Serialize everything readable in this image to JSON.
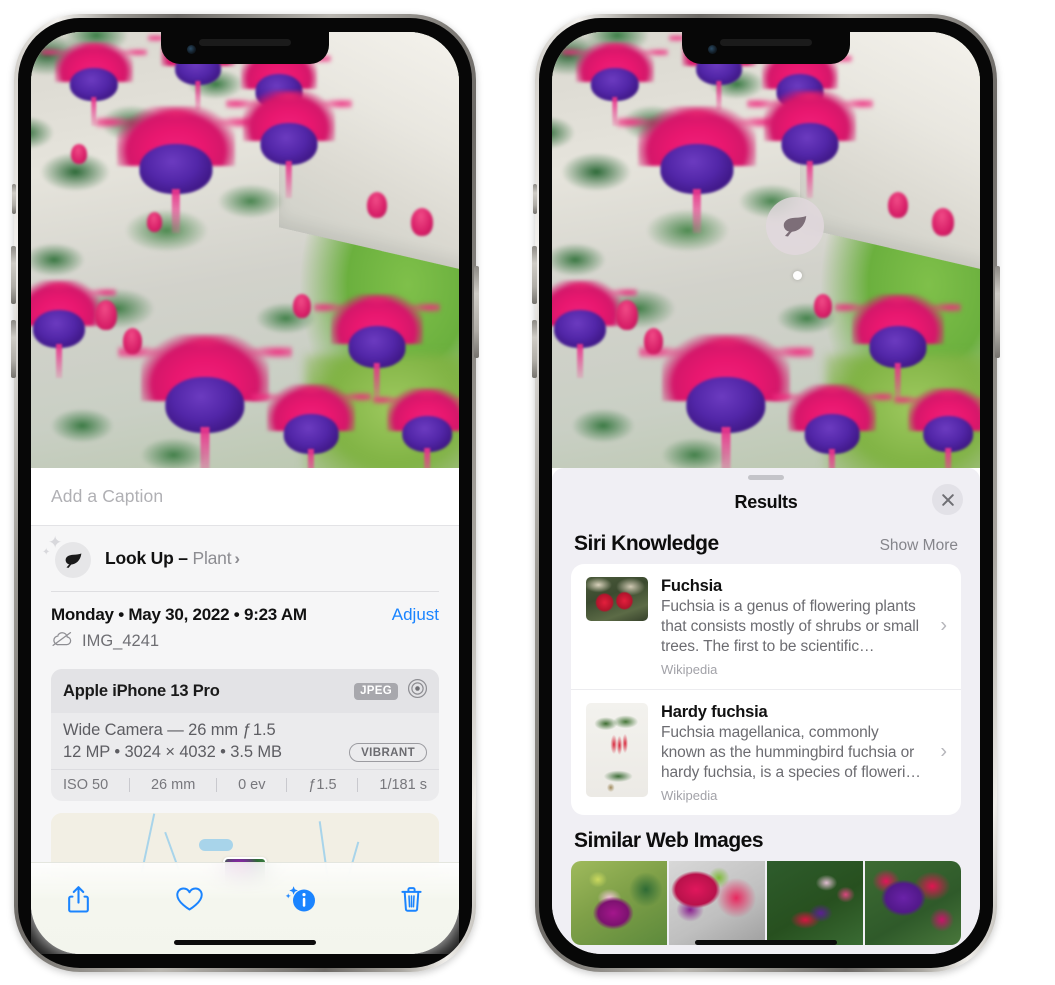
{
  "left_phone": {
    "name": "iphone-photos-info",
    "caption_field": {
      "placeholder": "Add a Caption",
      "value": ""
    },
    "look_up": {
      "icon": "leaf-icon",
      "label": "Look Up",
      "dash": "–",
      "subject": "Plant",
      "chevron": "›"
    },
    "date_row": {
      "date_text": "Monday • May 30, 2022 • 9:23 AM",
      "adjust_label": "Adjust"
    },
    "file_row": {
      "icon": "cloud-slash-icon",
      "filename": "IMG_4241"
    },
    "camera_card": {
      "model": "Apple iPhone 13 Pro",
      "format_badge": "JPEG",
      "aperture_icon": "camera-aperture-icon",
      "lens": "Wide Camera — 26 mm ƒ 1.5",
      "specs": "12 MP • 3024 × 4032 • 3.5 MB",
      "style_badge": "VIBRANT",
      "exif": [
        "ISO 50",
        "26 mm",
        "0 ev",
        "ƒ1.5",
        "1/181 s"
      ]
    },
    "map": {
      "name": "location-map",
      "pin": "photo-thumbnail-pin"
    },
    "toolbar": [
      {
        "name": "share-button",
        "icon": "share-icon"
      },
      {
        "name": "favorite-button",
        "icon": "heart-icon"
      },
      {
        "name": "info-button",
        "icon": "info-sparkle-icon"
      },
      {
        "name": "delete-button",
        "icon": "trash-icon"
      }
    ],
    "accent_color": "#1a84ff"
  },
  "right_phone": {
    "name": "iphone-visual-look-up-results",
    "badge": {
      "icon": "leaf-icon",
      "label": "visual-look-up-badge"
    },
    "sheet": {
      "grabber": "sheet-grabber",
      "title": "Results",
      "close_icon": "close-icon"
    },
    "siri_knowledge": {
      "section_title": "Siri Knowledge",
      "show_more": "Show More",
      "items": [
        {
          "title": "Fuchsia",
          "description": "Fuchsia is a genus of flowering plants that consists mostly of shrubs or small trees. The first to be scientific…",
          "source": "Wikipedia",
          "thumb": "fuchsia-red-flowers-thumbnail",
          "chevron": "›"
        },
        {
          "title": "Hardy fuchsia",
          "description": "Fuchsia magellanica, commonly known as the hummingbird fuchsia or hardy fuchsia, is a species of floweri…",
          "source": "Wikipedia",
          "thumb": "hardy-fuchsia-specimen-thumbnail",
          "chevron": "›"
        }
      ]
    },
    "similar_web_images": {
      "section_title": "Similar Web Images",
      "items": [
        {
          "name": "web-image-1",
          "alt": "pink and magenta fuchsia with green leaves"
        },
        {
          "name": "web-image-2",
          "alt": "close-up red and magenta fuchsia bloom"
        },
        {
          "name": "web-image-3",
          "alt": "fuchsia bush with many red buds"
        },
        {
          "name": "web-image-4",
          "alt": "purple and red double fuchsia flowers"
        }
      ]
    }
  },
  "photo": {
    "name": "fuchsia-flowers-photo",
    "alt": "Hanging basket of pink and purple fuchsia flowers on a porch"
  }
}
